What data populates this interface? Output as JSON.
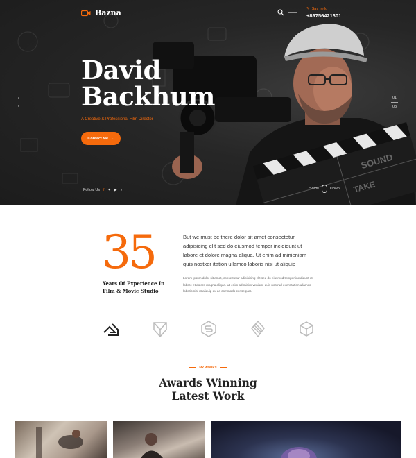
{
  "header": {
    "logo_text": "Bazna",
    "contact_label": "Say hello",
    "contact_phone": "+89756421301"
  },
  "hero": {
    "title_line1": "David",
    "title_line2": "Backhum",
    "subtitle": "A Creative & Professional Film Director",
    "cta_label": "Contact Me",
    "follow_label": "Follow Us",
    "scroll_label": "Scroll",
    "down_label": "Down",
    "slide_current": "01",
    "slide_total": "03"
  },
  "about": {
    "number": "35",
    "years_line1": "Years Of Experience In",
    "years_line2": "Film & Movie Studio",
    "lead": "But we must be there dolor sit amet consectetur adipisicing elit sed do eiusmod tempor incididunt ut labore et dolore magna aliqua. Ut enim ad minieniam quis nostxer itation ullamco laboris nisi ut aliquip",
    "small": "Lorem ipsum dolor sit amet, consectetur adipisicing elit sed do eiusmod tempor incididunt ut labore et dolore magna aliqua. Ut enim ad minim veniam, quis nostrud exercitation ullamco laboris nisi ut aliquip ex ea commodo consequat."
  },
  "works": {
    "label": "MY WORKS",
    "title_line1": "Awards Winning",
    "title_line2": "Latest Work"
  },
  "colors": {
    "accent": "#f56a0c",
    "dark": "#222222"
  },
  "icons": [
    "camera-icon",
    "search-icon",
    "menu-icon",
    "pen-icon",
    "arrow-right-icon",
    "facebook-icon",
    "twitter-icon",
    "youtube-icon",
    "vimeo-icon",
    "mouse-icon"
  ]
}
